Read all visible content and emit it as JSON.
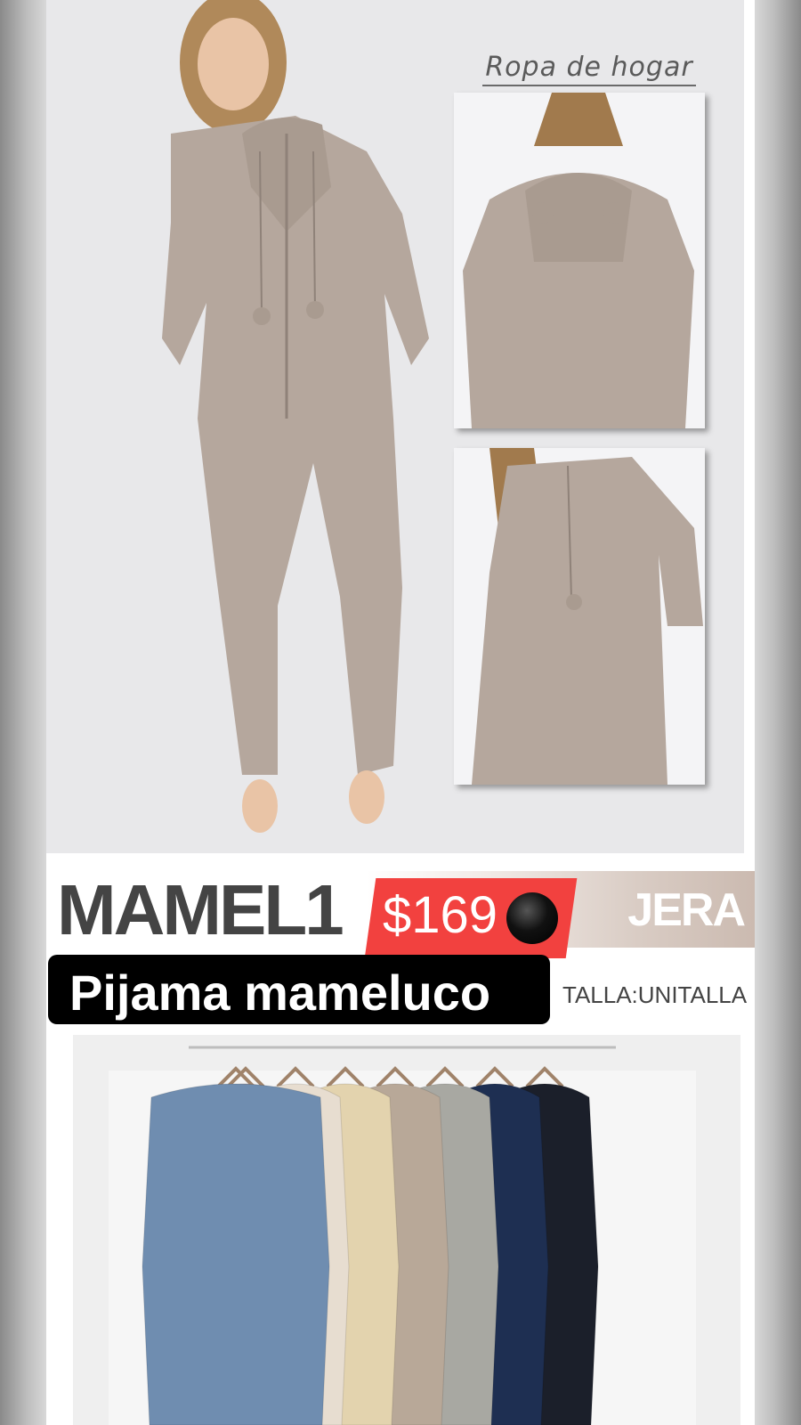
{
  "header": {
    "script_title": "Ropa de hogar"
  },
  "product": {
    "code": "MAMEL1",
    "price": "$169",
    "brand": "JERA",
    "name": "Pijama mameluco",
    "size": "TALLA:UNITALLA"
  },
  "colors": {
    "swatches": [
      "#6f8db0",
      "#d8a79b",
      "#e7ddd0",
      "#e3d3ae",
      "#b8a898",
      "#a8a8a2",
      "#1e2f52",
      "#1b1f2a"
    ]
  },
  "photo": {
    "fabric_color": "#b5a79d"
  }
}
